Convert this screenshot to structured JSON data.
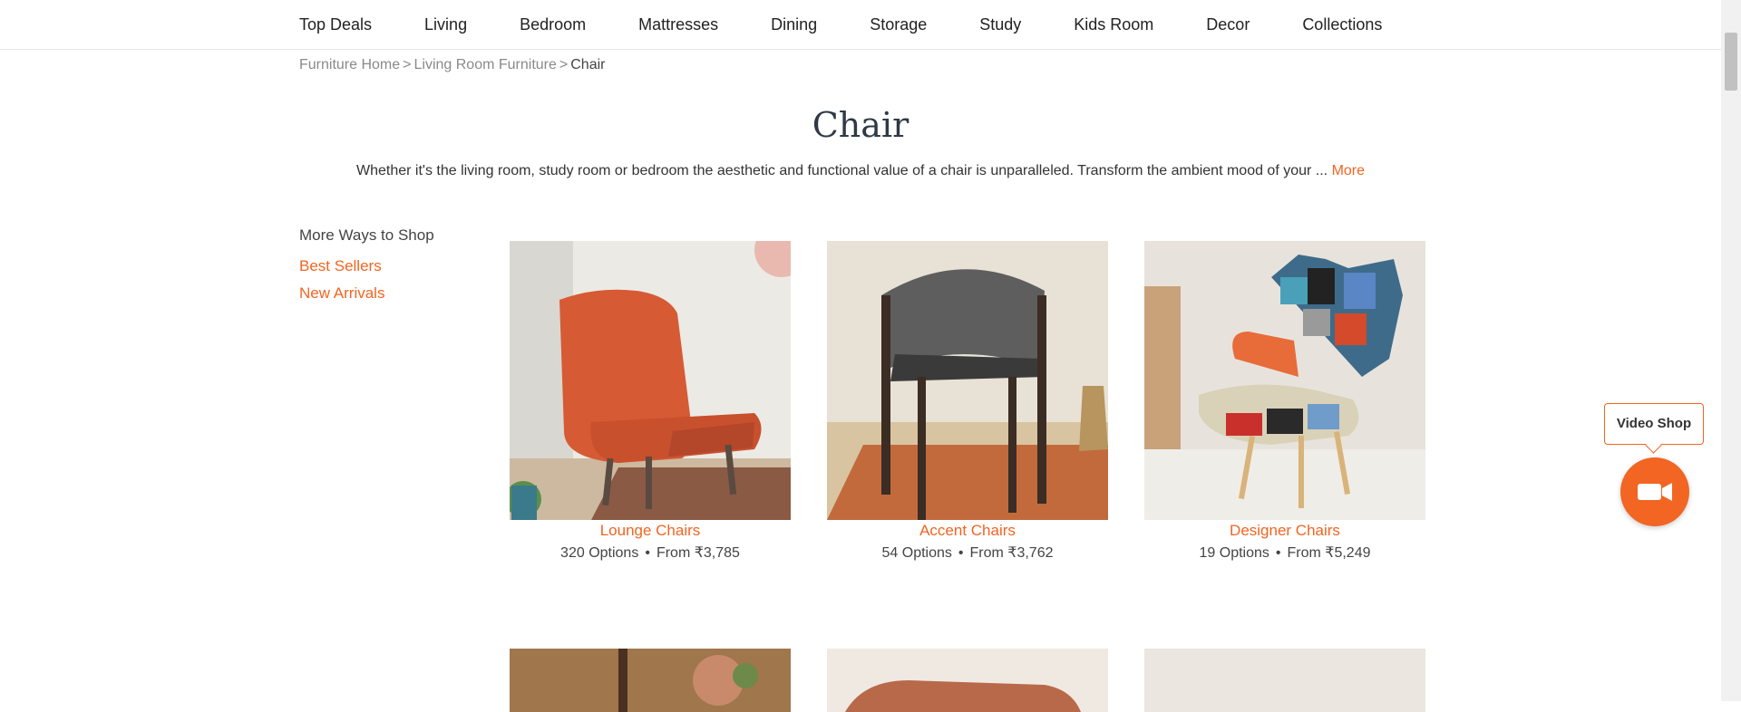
{
  "nav": {
    "items": [
      {
        "label": "Top Deals"
      },
      {
        "label": "Living"
      },
      {
        "label": "Bedroom"
      },
      {
        "label": "Mattresses"
      },
      {
        "label": "Dining"
      },
      {
        "label": "Storage"
      },
      {
        "label": "Study"
      },
      {
        "label": "Kids Room"
      },
      {
        "label": "Decor"
      },
      {
        "label": "Collections"
      }
    ]
  },
  "breadcrumb": {
    "home": "Furniture Home",
    "parent": "Living Room Furniture",
    "separator": ">",
    "current": "Chair"
  },
  "page": {
    "title": "Chair",
    "description": "Whether it's the living room, study room or bedroom the aesthetic and functional value of a chair is unparalleled. Transform the ambient mood of your ...",
    "more_label": "More"
  },
  "sidebar": {
    "title": "More Ways to Shop",
    "links": [
      {
        "label": "Best Sellers"
      },
      {
        "label": "New Arrivals"
      }
    ]
  },
  "categories": [
    {
      "name": "Lounge Chairs",
      "options": "320 Options",
      "dot": "•",
      "price": "From ₹3,785"
    },
    {
      "name": "Accent Chairs",
      "options": "54 Options",
      "dot": "•",
      "price": "From ₹3,762"
    },
    {
      "name": "Designer Chairs",
      "options": "19 Options",
      "dot": "•",
      "price": "From ₹5,249"
    }
  ],
  "video_shop": {
    "label": "Video Shop",
    "icon": "video-camera-icon"
  },
  "colors": {
    "accent": "#f26522",
    "title": "#2e3a46"
  }
}
